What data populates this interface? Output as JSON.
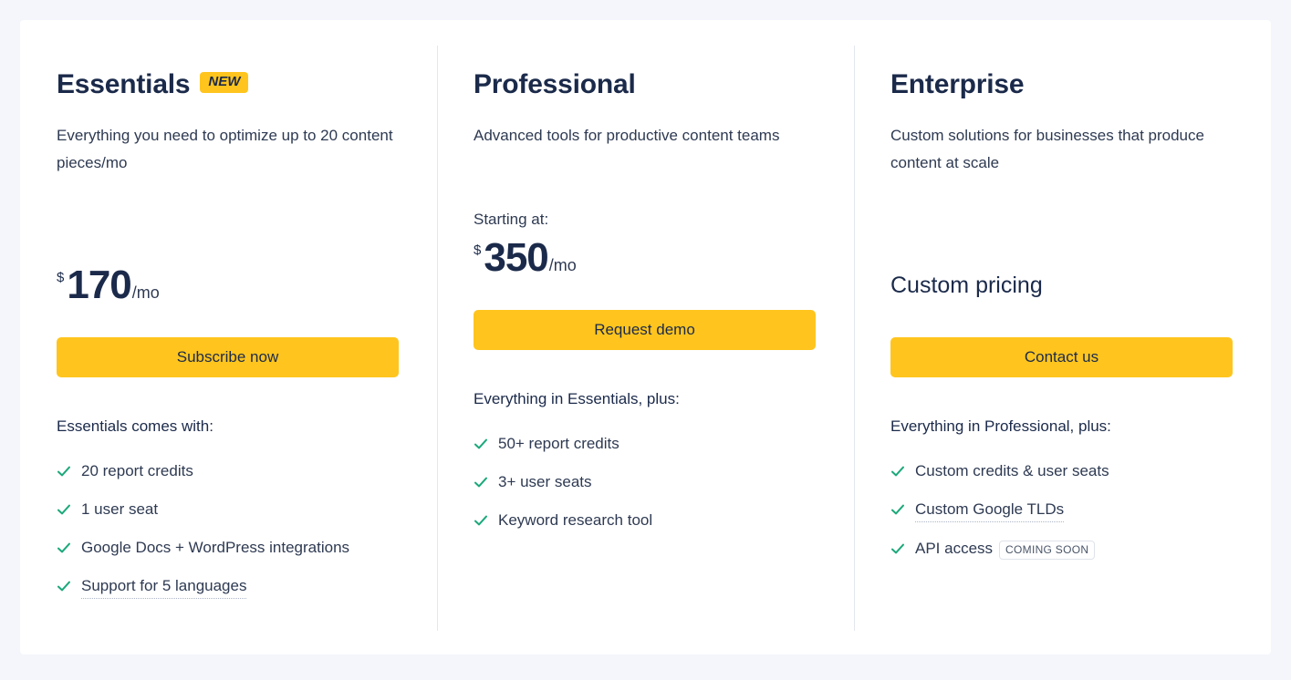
{
  "theme": {
    "page_background": "#f4f6fb",
    "card_background": "#ffffff",
    "accent_yellow": "#ffc51e",
    "heading_navy": "#1b2a4a",
    "body_slate": "#2e3a52",
    "check_green": "#1ca87b",
    "divider_gray": "#e4e7ee"
  },
  "plans": [
    {
      "name": "Essentials",
      "badge": "NEW",
      "description": "Everything you need to optimize up to 20 content pieces/mo",
      "starting_at_label": "",
      "currency": "$",
      "amount": "170",
      "period": "/mo",
      "cta_label": "Subscribe now",
      "features_title": "Essentials comes with:",
      "features": [
        {
          "text": "20 report credits",
          "tooltip": false,
          "badge": ""
        },
        {
          "text": "1 user seat",
          "tooltip": false,
          "badge": ""
        },
        {
          "text": "Google Docs + WordPress integrations",
          "tooltip": false,
          "badge": ""
        },
        {
          "text": "Support for 5 languages",
          "tooltip": true,
          "badge": ""
        }
      ]
    },
    {
      "name": "Professional",
      "badge": "",
      "description": "Advanced tools for productive content teams",
      "starting_at_label": "Starting at:",
      "currency": "$",
      "amount": "350",
      "period": "/mo",
      "cta_label": "Request demo",
      "features_title": "Everything in Essentials, plus:",
      "features": [
        {
          "text": "50+ report credits",
          "tooltip": false,
          "badge": ""
        },
        {
          "text": "3+ user seats",
          "tooltip": false,
          "badge": ""
        },
        {
          "text": "Keyword research tool",
          "tooltip": false,
          "badge": ""
        }
      ]
    },
    {
      "name": "Enterprise",
      "badge": "",
      "description": "Custom solutions for businesses that produce content at scale",
      "starting_at_label": "",
      "custom_price": "Custom pricing",
      "cta_label": "Contact us",
      "features_title": "Everything in Professional, plus:",
      "features": [
        {
          "text": "Custom credits & user seats",
          "tooltip": false,
          "badge": ""
        },
        {
          "text": "Custom Google TLDs",
          "tooltip": true,
          "badge": ""
        },
        {
          "text": "API access",
          "tooltip": false,
          "badge": "COMING SOON"
        }
      ]
    }
  ]
}
